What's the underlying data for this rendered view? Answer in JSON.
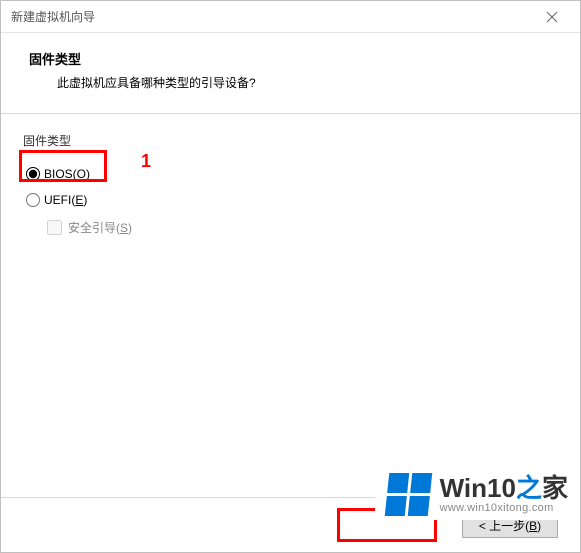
{
  "titlebar": {
    "title": "新建虚拟机向导"
  },
  "header": {
    "title": "固件类型",
    "subtitle": "此虚拟机应具备哪种类型的引导设备?"
  },
  "group": {
    "label": "固件类型"
  },
  "options": {
    "bios": {
      "prefix": "BIOS(",
      "mnemonic": "O",
      "suffix": ")"
    },
    "uefi": {
      "prefix": "UEFI(",
      "mnemonic": "E",
      "suffix": ")"
    },
    "secure_boot": {
      "prefix": "安全引导(",
      "mnemonic": "S",
      "suffix": ")"
    }
  },
  "annotations": {
    "one": "1"
  },
  "buttons": {
    "back": {
      "prefix": "< 上一步(",
      "mnemonic": "B",
      "suffix": ")"
    }
  },
  "watermark": {
    "brand_prefix": "Win10",
    "brand_mid": "之",
    "brand_suffix": "家",
    "url": "www.win10xitong.com"
  }
}
